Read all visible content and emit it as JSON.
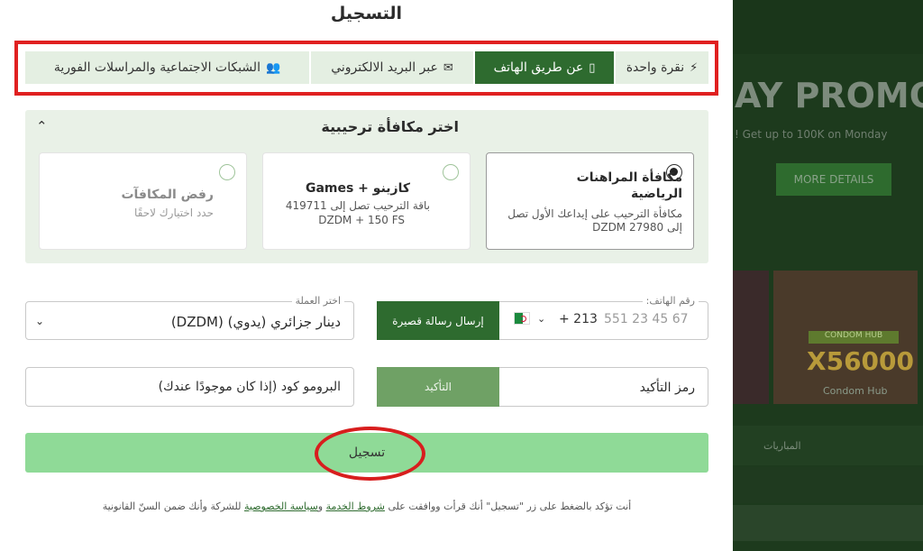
{
  "colors": {
    "accent_dark_green": "#2e6b2f",
    "tab_inactive": "#e4efe2",
    "bonus_bg": "#e9f1e7",
    "register_bg": "#8fda97",
    "highlight_red": "#e02020"
  },
  "title": "التسجيل",
  "tabs": [
    {
      "label": "نقرة واحدة",
      "icon": "lightning-icon",
      "active": false
    },
    {
      "label": "عن طريق الهاتف",
      "icon": "phone-icon",
      "active": true
    },
    {
      "label": "عبر البريد الالكتروني",
      "icon": "envelope-icon",
      "active": false
    },
    {
      "label": "الشبكات الاجتماعية والمراسلات الفورية",
      "icon": "users-icon",
      "active": false
    }
  ],
  "bonus": {
    "title": "اختر مكافأة ترحيبية",
    "cards": [
      {
        "title": "مكافأة المراهنات الرياضية",
        "desc": "مكافأة الترحيب على إيداعك الأول تصل إلى 27980 DZDM",
        "selected": true
      },
      {
        "title": "كازينو + Games",
        "desc_line1": "باقة الترحيب تصل إلى 419711",
        "desc_line2": "DZDM + 150 FS",
        "selected": false
      },
      {
        "title": "رفض المكافآت",
        "desc": "حدد اختيارك لاحقًا",
        "selected": false
      }
    ]
  },
  "form": {
    "phone_label": "رقم الهاتف:",
    "phone_code": "+ 213",
    "phone_placeholder": "551 23 45 67",
    "sms_button": "إرسال رسالة قصيرة",
    "currency_label": "اختر العملة",
    "currency_value": "دينار جزائري (يدوي) (DZDM)",
    "confirmation_code": "رمز التأكيد",
    "confirm_button": "التأكيد",
    "promo_code": "البرومو كود (إذا كان موجودًا عندك)",
    "register_button": "تسجيل"
  },
  "terms": {
    "part1": "أنت تؤكد بالضغط على زر \"تسجيل\" أنك قرأت ووافقت على ",
    "link1": "شروط الخدمة",
    "part2": " و",
    "link2": "سياسة الخصوصية",
    "part3": " للشركة وأنك ضمن السنّ القانونية"
  },
  "background_site": {
    "promo_title": "AY PROMO",
    "promo_sub": "! Get up to 100K on Monday",
    "more_details": "MORE DETAILS",
    "game_badge": "CONDOM HUB",
    "game_value": "X56000",
    "game_caption": "Condom Hub",
    "tab_matches": "المباريات"
  }
}
